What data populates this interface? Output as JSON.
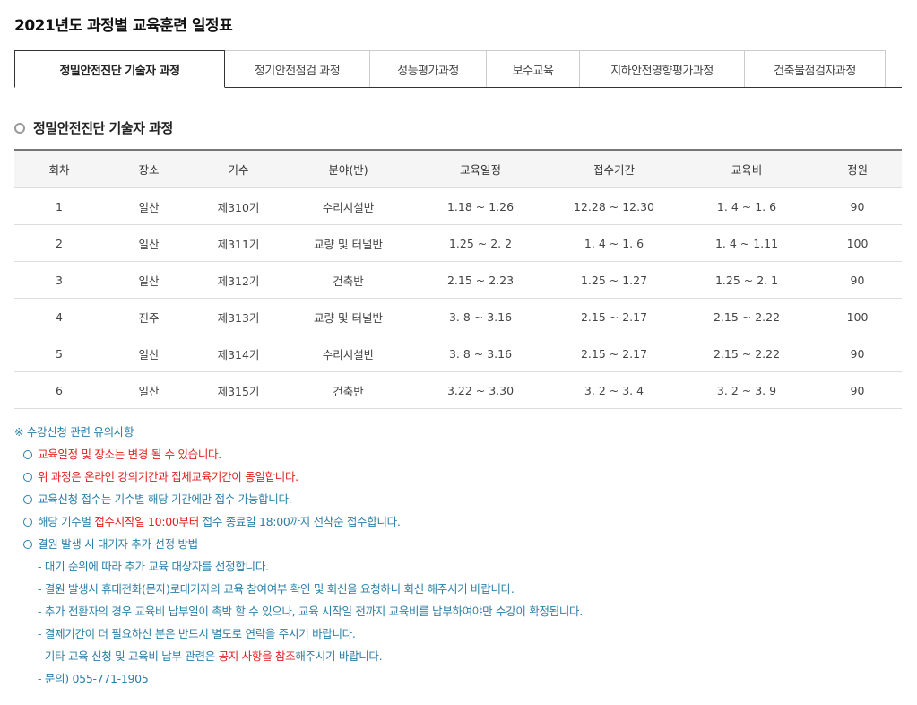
{
  "page_title": "2021년도 과정별 교육훈련 일정표",
  "tabs": [
    {
      "label": "정밀안전진단 기술자 과정",
      "active": true
    },
    {
      "label": "정기안전점검 과정"
    },
    {
      "label": "성능평가과정"
    },
    {
      "label": "보수교육"
    },
    {
      "label": "지하안전영향평가과정"
    },
    {
      "label": "건축물점검자과정"
    }
  ],
  "section_title": "정밀안전진단 기술자 과정",
  "table": {
    "headers": [
      "회차",
      "장소",
      "기수",
      "분야(반)",
      "교육일정",
      "접수기간",
      "교육비",
      "정원"
    ],
    "rows": [
      [
        "1",
        "일산",
        "제310기",
        "수리시설반",
        "1.18 ~ 1.26",
        "12.28 ~ 12.30",
        "1. 4 ~ 1. 6",
        "90"
      ],
      [
        "2",
        "일산",
        "제311기",
        "교량 및 터널반",
        "1.25 ~ 2. 2",
        "1. 4 ~ 1. 6",
        "1. 4 ~ 1.11",
        "100"
      ],
      [
        "3",
        "일산",
        "제312기",
        "건축반",
        "2.15 ~ 2.23",
        "1.25 ~ 1.27",
        "1.25 ~ 2. 1",
        "90"
      ],
      [
        "4",
        "진주",
        "제313기",
        "교량 및 터널반",
        "3. 8 ~ 3.16",
        "2.15 ~ 2.17",
        "2.15 ~ 2.22",
        "100"
      ],
      [
        "5",
        "일산",
        "제314기",
        "수리시설반",
        "3. 8 ~ 3.16",
        "2.15 ~ 2.17",
        "2.15 ~ 2.22",
        "90"
      ],
      [
        "6",
        "일산",
        "제315기",
        "건축반",
        "3.22 ~ 3.30",
        "3. 2 ~ 3. 4",
        "3. 2 ~ 3. 9",
        "90"
      ]
    ]
  },
  "notes": {
    "heading": "※ 수강신청 관련 유의사항",
    "item1": "교육일정 및 장소는 변경 될 수 있습니다.",
    "item2": "위 과정은 온라인 강의기간과 집체교육기간이 동일합니다.",
    "item3": "교육신청 접수는 기수별 해당 기간에만 접수 가능합니다.",
    "item4_a": "해당 기수별 ",
    "item4_b": "접수시작일 10:00부터",
    "item4_c": " 접수 종료일 18:00까지 선착순 접수합니다.",
    "item5": "결원 발생 시 대기자 추가 선정 방법",
    "sub1": "- 대기 순위에 따라 추가 교육 대상자를 선정합니다.",
    "sub2": "- 결원 발생시 휴대전화(문자)로대기자의 교육 참여여부 확인 및 회신을 요청하니 회신 해주시기 바랍니다.",
    "sub3": "- 추가 전환자의 경우 교육비 납부일이 촉박 할 수 있으나, 교육 시작일 전까지 교육비를 납부하여야만 수강이 확정됩니다.",
    "sub4": "- 결제기간이 더 필요하신 분은 반드시 별도로 연락을 주시기 바랍니다.",
    "sub5_a": "- 기타 교육 신청 및 교육비 납부 관련은 ",
    "sub5_b": "공지 사항을 참조",
    "sub5_c": "해주시기 바랍니다.",
    "sub6": "- 문의) 055-771-1905"
  }
}
